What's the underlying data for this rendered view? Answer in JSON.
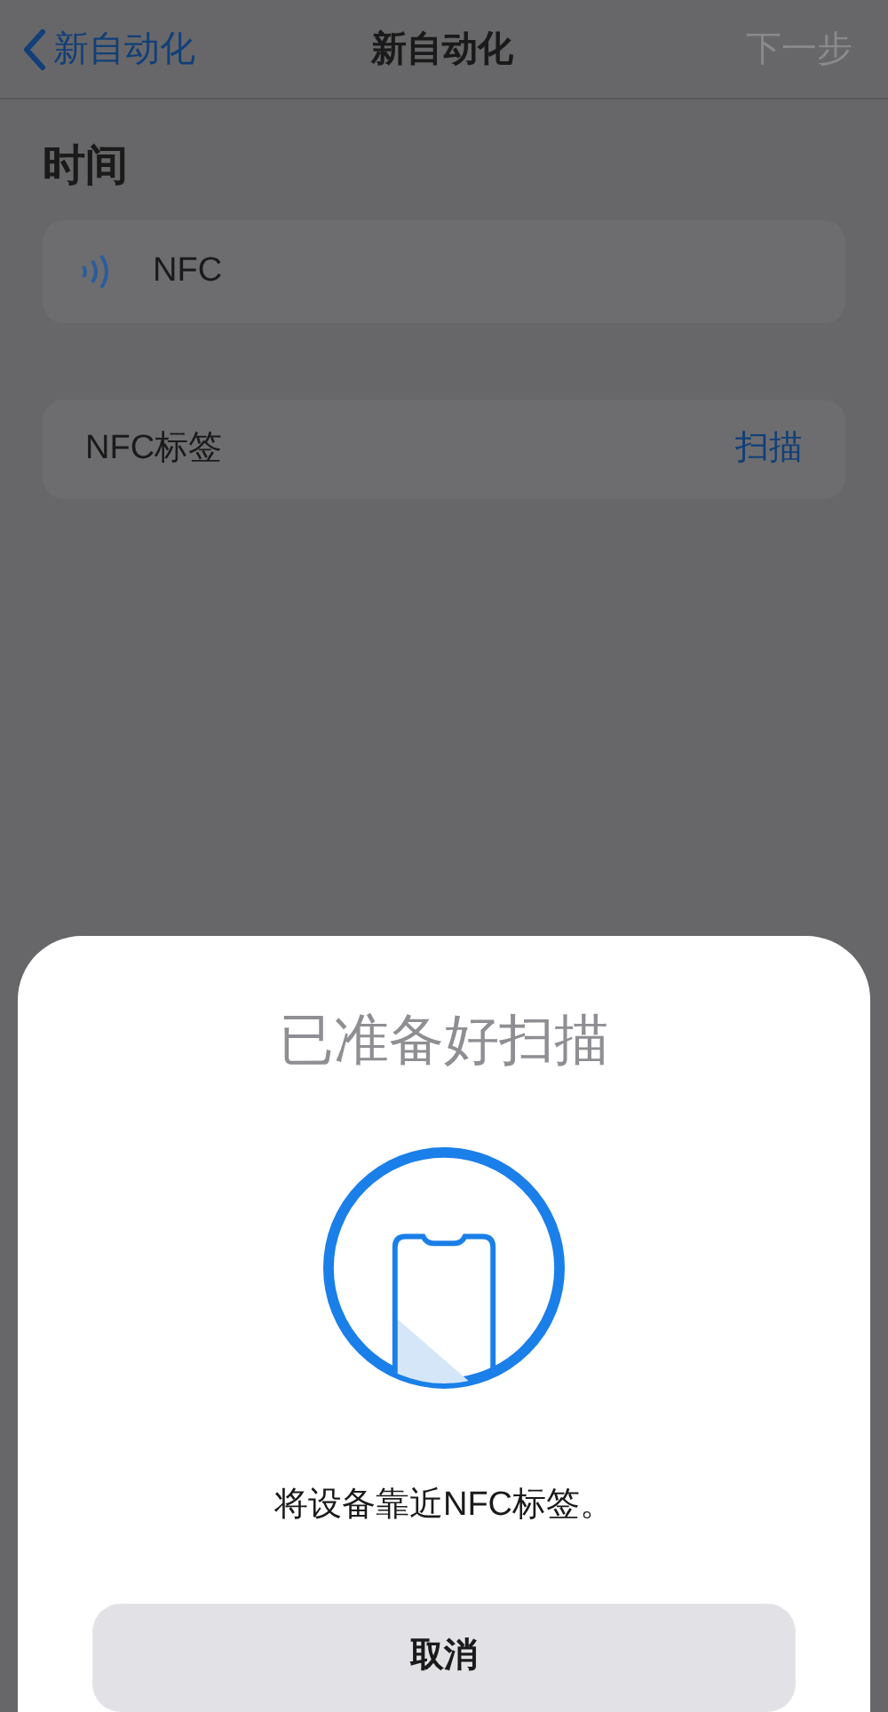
{
  "nav": {
    "back": "新自动化",
    "title": "新自动化",
    "next": {
      "label": "下一步",
      "disabled": true
    }
  },
  "section_title": "时间",
  "trigger": {
    "label": "NFC"
  },
  "tag_row": {
    "label": "NFC标签",
    "action": "扫描"
  },
  "sheet": {
    "title": "已准备好扫描",
    "message": "将设备靠近NFC标签。",
    "cancel": "取消"
  }
}
